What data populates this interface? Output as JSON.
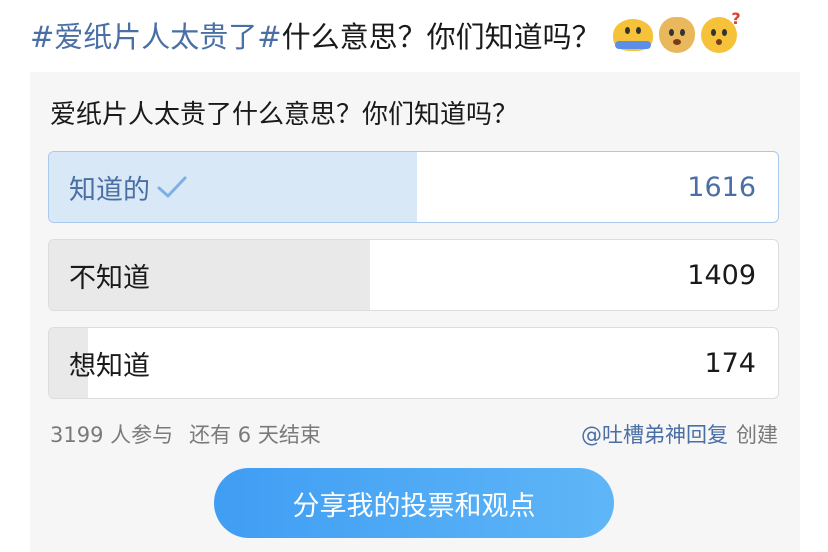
{
  "post": {
    "topic": "#爱纸片人太贵了#",
    "title": "什么意思？你们知道吗？",
    "emojis": [
      "shrug-emoji",
      "doge-emoji",
      "thinking-emoji"
    ]
  },
  "poll": {
    "question": "爱纸片人太贵了什么意思？你们知道吗？",
    "options": [
      {
        "label": "知道的",
        "count": "1616",
        "share": 0.505,
        "selected": true
      },
      {
        "label": "不知道",
        "count": "1409",
        "share": 0.44,
        "selected": false
      },
      {
        "label": "想知道",
        "count": "174",
        "share": 0.054,
        "selected": false
      }
    ],
    "participants": "3199 人参与",
    "deadline": "还有 6 天结束",
    "creator": "@吐槽弟神回复",
    "created_label": "创建",
    "share_button": "分享我的投票和观点"
  },
  "colors": {
    "accent_text": "#4a6fa5",
    "selected_fill": "#d9e8f6",
    "unselected_fill": "#e9e9e9",
    "button_blue": "#3f9df3"
  }
}
